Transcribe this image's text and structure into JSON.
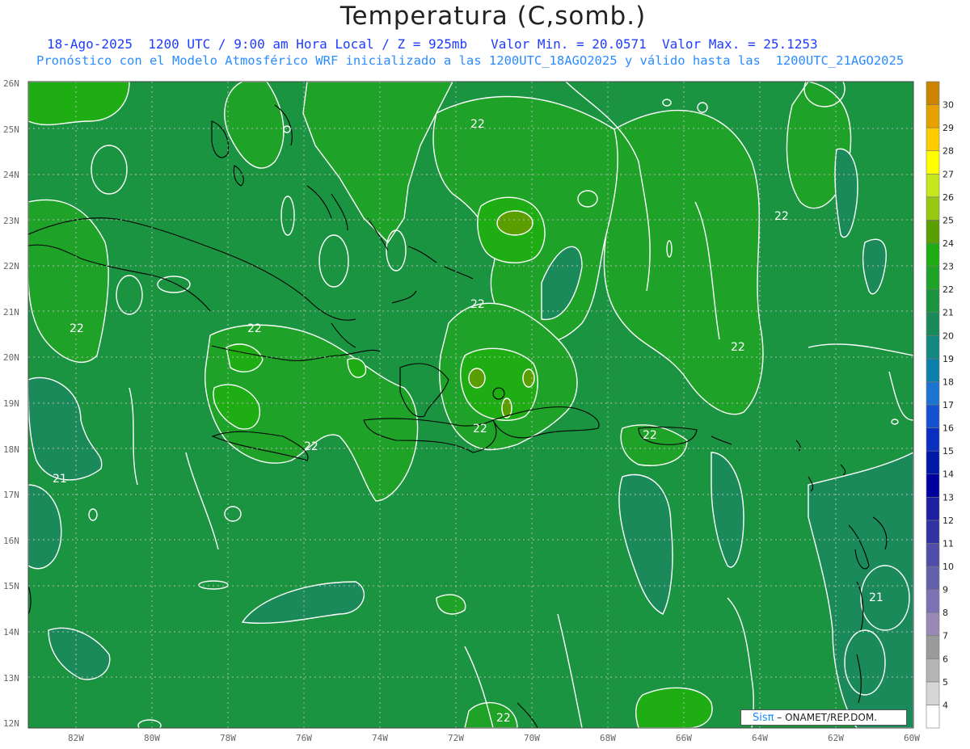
{
  "title": "Temperatura (C,somb.)",
  "subtitle_line1": "18-Ago-2025  1200 UTC / 9:00 am Hora Local / Z = 925mb   Valor Min. = 20.0571  Valor Max. = 25.1253",
  "subtitle_line2": "Pronóstico con el Modelo Atmosférico WRF inicializado a las 1200UTC_18AGO2025 y válido hasta las  1200UTC_21AGO2025",
  "credit": {
    "brand": "Sisπ",
    "text": "– ONAMET/REP.DOM."
  },
  "lat_labels": [
    "26N",
    "25N",
    "24N",
    "23N",
    "22N",
    "21N",
    "20N",
    "19N",
    "18N",
    "17N",
    "16N",
    "15N",
    "14N",
    "13N",
    "12N"
  ],
  "lon_labels": [
    "82W",
    "80W",
    "78W",
    "76W",
    "74W",
    "72W",
    "70W",
    "68W",
    "66W",
    "64W",
    "62W",
    "60W"
  ],
  "colorbar": {
    "levels": [
      4,
      5,
      6,
      7,
      8,
      9,
      10,
      11,
      12,
      13,
      14,
      15,
      16,
      17,
      18,
      19,
      20,
      21,
      22,
      23,
      24,
      25,
      26,
      27,
      28,
      29,
      30
    ],
    "colors": [
      "#ffffff",
      "#d6d6d6",
      "#b4b4b4",
      "#9a9a9a",
      "#9a88b6",
      "#7d72b4",
      "#6262aa",
      "#4e4ea8",
      "#3232a4",
      "#1e1ea0",
      "#0000a0",
      "#0018a8",
      "#0a2ec0",
      "#1450d0",
      "#1a74d0",
      "#0c80a8",
      "#128880",
      "#1a8a5a",
      "#1a9440",
      "#1ea228",
      "#1eae14",
      "#5a9e00",
      "#98c812",
      "#c4e81c",
      "#ffff00",
      "#ffcc00",
      "#e6a000",
      "#cc8400"
    ]
  },
  "contour_labels": [
    "22",
    "22",
    "22",
    "22",
    "22",
    "22",
    "22",
    "22",
    "22",
    "21",
    "21",
    "22",
    "22"
  ],
  "map_colors": {
    "background": "#1a9440",
    "warm": "#1ea228",
    "warmer": "#1eae14",
    "cool": "#1a8a5a",
    "hot": "#5a9e00"
  }
}
